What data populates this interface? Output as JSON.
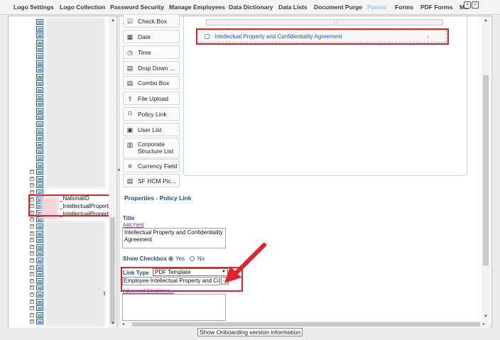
{
  "tabs": [
    {
      "label": "Logo Settings",
      "active": false
    },
    {
      "label": "Logo Collection",
      "active": false
    },
    {
      "label": "Password Security",
      "active": false
    },
    {
      "label": "Manage Employees",
      "active": false
    },
    {
      "label": "Data Dictionary",
      "active": false
    },
    {
      "label": "Data Lists",
      "active": false
    },
    {
      "label": "Document Purge",
      "active": false
    },
    {
      "label": "Panels",
      "active": true
    },
    {
      "label": "Forms",
      "active": false
    },
    {
      "label": "PDF Forms",
      "active": false
    },
    {
      "label": "Ma",
      "active": false
    }
  ],
  "tab_nav": {
    "prev": "«",
    "next": "»"
  },
  "tree": {
    "labels": [
      "_NationalID",
      "_IntellectualProperty",
      "_IntellectualProperty"
    ],
    "partial_char": "t"
  },
  "toolbox": [
    {
      "label": "Check Box",
      "icon": "checkbox-icon"
    },
    {
      "label": "Date",
      "icon": "calendar-icon"
    },
    {
      "label": "Time",
      "icon": "clock-icon"
    },
    {
      "label": "Drop Down ...",
      "icon": "dropdown-icon"
    },
    {
      "label": "Combo Box",
      "icon": "combobox-icon"
    },
    {
      "label": "File Upload",
      "icon": "upload-icon"
    },
    {
      "label": "Policy Link",
      "icon": "link-icon"
    },
    {
      "label": "User List",
      "icon": "userlist-icon"
    },
    {
      "label": "Corporate Structure List",
      "icon": "structure-icon"
    },
    {
      "label": "Currency Field",
      "icon": "currency-icon"
    },
    {
      "label": "SF HCM Pic...",
      "icon": "picker-icon"
    }
  ],
  "canvas": {
    "field_label": "Intellectual Property and Confidentiality Agreement"
  },
  "properties": {
    "header": "Properties - Policy Link",
    "title_label": "Title",
    "add_field": "Add Field",
    "title_value": "Intellectual Property and Confidentiality Agreement",
    "show_checkbox_label": "Show Checkbox",
    "yes": "Yes",
    "no": "No",
    "show_checkbox_value": "Yes",
    "link_type_label": "Link Type",
    "link_type_value": "PDF Template",
    "template_value": "Employee Intellectual Property and Co",
    "ellipsis": "...",
    "advanced_conditions": "Advanced Conditions..."
  },
  "footer": {
    "onboarding_button": "Show Onboarding version information"
  },
  "colors": {
    "highlight": "#e0232e",
    "active_tab": "#9ec6e6",
    "link_blue": "#1f5fbf",
    "header_blue": "#1f4f8f"
  }
}
